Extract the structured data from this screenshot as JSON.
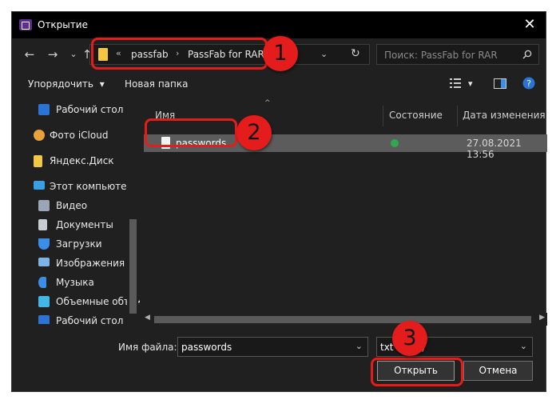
{
  "window": {
    "title": "Открытие",
    "close": "✕"
  },
  "nav": {
    "back": "←",
    "forward": "→",
    "recent": "⌄",
    "up": "↑"
  },
  "address": {
    "prefix": "«",
    "crumbs": [
      "passfab",
      "PassFab for RAR"
    ],
    "sep": "›",
    "dropdown": "⌄",
    "refresh": "↻"
  },
  "search": {
    "placeholder": "Поиск: PassFab for RAR"
  },
  "commands": {
    "organize": "Упорядочить",
    "organize_arrow": "▾",
    "new_folder": "Новая папка",
    "view_arrow": "▾"
  },
  "sidebar": {
    "items": [
      {
        "label": "Рабочий стол",
        "icon": "desktop-icon",
        "color": "#2b74d6"
      },
      {
        "label": "Фото iCloud",
        "icon": "icloud-photos-icon",
        "color": "#e9a23b"
      },
      {
        "label": "Яндекс.Диск",
        "icon": "folder-icon",
        "color": "#f3c744"
      },
      {
        "label": "Этот компьютер",
        "icon": "computer-icon",
        "color": "#3aa0e6"
      },
      {
        "label": "Видео",
        "icon": "video-icon",
        "color": "#9aa6b5"
      },
      {
        "label": "Документы",
        "icon": "documents-icon",
        "color": "#c9cdd3"
      },
      {
        "label": "Загрузки",
        "icon": "downloads-icon",
        "color": "#3b8ee8"
      },
      {
        "label": "Изображения",
        "icon": "pictures-icon",
        "color": "#7fb3e6"
      },
      {
        "label": "Музыка",
        "icon": "music-icon",
        "color": "#3b8ee8"
      },
      {
        "label": "Объемные объекты",
        "icon": "3d-objects-icon",
        "color": "#43b6e8"
      },
      {
        "label": "Рабочий стол",
        "icon": "desktop-icon",
        "color": "#2b74d6"
      }
    ]
  },
  "columns": {
    "name": "Имя",
    "status": "Состояние",
    "modified": "Дата изменения",
    "sort_indicator": "^"
  },
  "files": [
    {
      "name": "passwords",
      "status": "synced",
      "modified": "27.08.2021 13:56"
    }
  ],
  "footer": {
    "filename_label": "Имя файла:",
    "filename_value": "passwords",
    "filetype_value": "txt (*.txt)",
    "open_label": "Открыть",
    "cancel_label": "Отмена"
  },
  "annotations": {
    "callout_1": "1",
    "callout_2": "2",
    "callout_3": "3",
    "color": "#e41c1c"
  }
}
